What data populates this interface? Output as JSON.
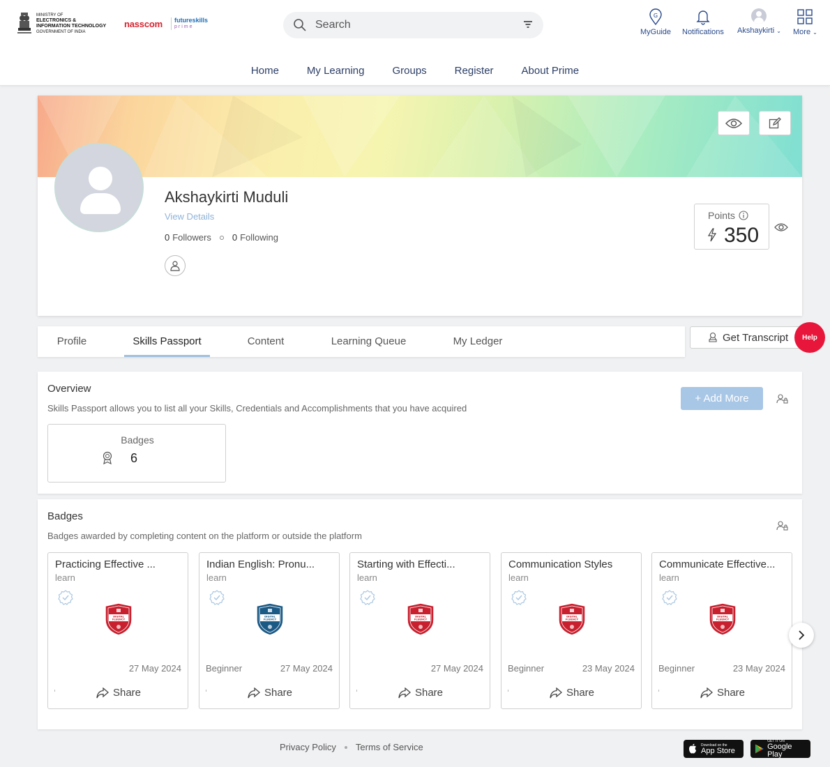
{
  "header": {
    "ministry_lines": [
      "MINISTRY OF",
      "ELECTRONICS &",
      "INFORMATION TECHNOLOGY",
      "GOVERNMENT OF INDIA"
    ],
    "partner1": "nasscom",
    "partner2": "futureskills",
    "partner2_sub": "prime",
    "search_placeholder": "Search",
    "actions": {
      "myguide": "MyGuide",
      "notifications": "Notifications",
      "user": "Akshaykirti",
      "more": "More"
    }
  },
  "nav": [
    "Home",
    "My Learning",
    "Groups",
    "Register",
    "About Prime"
  ],
  "profile": {
    "name": "Akshaykirti Muduli",
    "view_details": "View Details",
    "followers_count": "0",
    "followers_label": "Followers",
    "following_count": "0",
    "following_label": "Following",
    "points_label": "Points",
    "points_value": "350"
  },
  "tabs": [
    "Profile",
    "Skills Passport",
    "Content",
    "Learning Queue",
    "My Ledger"
  ],
  "active_tab": "Skills Passport",
  "transcript_label": "Get Transcript",
  "help_label": "Help",
  "overview": {
    "title": "Overview",
    "subtitle": "Skills Passport allows you to list all your Skills, Credentials and Accomplishments that you have acquired",
    "add_more": "+ Add More",
    "stat_label": "Badges",
    "stat_value": "6"
  },
  "badges": {
    "title": "Badges",
    "subtitle": "Badges awarded by completing content on the platform or outside the platform",
    "share_label": "Share",
    "items": [
      {
        "title": "Practicing Effective ...",
        "type": "learn",
        "level": "",
        "date": "27 May 2024",
        "color": "#c8202e"
      },
      {
        "title": "Indian English: Pronu...",
        "type": "learn",
        "level": "Beginner",
        "date": "27 May 2024",
        "color": "#1c5a86"
      },
      {
        "title": "Starting with Effecti...",
        "type": "learn",
        "level": "",
        "date": "27 May 2024",
        "color": "#c8202e"
      },
      {
        "title": "Communication Styles",
        "type": "learn",
        "level": "Beginner",
        "date": "23 May 2024",
        "color": "#c8202e"
      },
      {
        "title": "Communicate Effective...",
        "type": "learn",
        "level": "Beginner",
        "date": "23 May 2024",
        "color": "#c8202e"
      }
    ],
    "shield_text": "DIGITAL FLUENCY"
  },
  "footer": {
    "privacy": "Privacy Policy",
    "terms": "Terms of Service",
    "appstore_small": "Download on the",
    "appstore_big": "App Store",
    "gplay_small": "GET IT ON",
    "gplay_big": "Google Play"
  },
  "colors": {
    "accent_blue": "#2c3e66",
    "add_more_bg": "#a8c6e6",
    "help_red": "#e8163a",
    "tab_underline": "#9fc0df"
  }
}
